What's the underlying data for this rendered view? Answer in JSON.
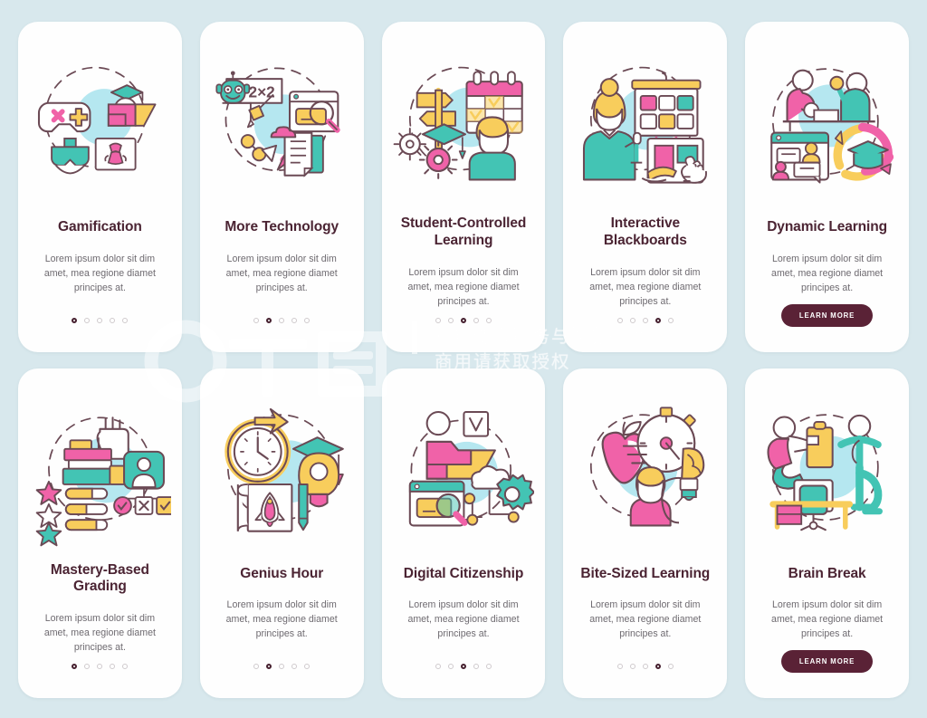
{
  "page": {
    "background_color": "#d8e8ed",
    "card_background": "#fefefe",
    "title_color": "#4b2433",
    "body_color": "#6e6a70",
    "accent_pink": "#f062a8",
    "accent_teal": "#43c4b4",
    "accent_yellow": "#f8cd5c",
    "accent_lightblue": "#b5e7f0",
    "outline_color": "#6b4a55",
    "cta_color": "#5a2236"
  },
  "watermark": {
    "logo_text": "千图",
    "line1": "营销创意服务与协作平台",
    "line2": "商用请获取授权"
  },
  "common": {
    "description": "Lorem ipsum dolor sit dim amet, mea regione diamet principes at.",
    "cta_label": "LEARN MORE",
    "dot_count": 5
  },
  "cards": [
    {
      "id": "gamification",
      "title": "Gamification",
      "icon_name": "gamepad-vr-graduation-icon",
      "description": "Lorem ipsum dolor sit dim amet, mea regione diamet principes at.",
      "active_dot": 0,
      "has_cta": false,
      "two_line_title": false
    },
    {
      "id": "more-technology",
      "title": "More Technology",
      "icon_name": "robot-browser-document-icon",
      "description": "Lorem ipsum dolor sit dim amet, mea regione diamet principes at.",
      "active_dot": 1,
      "has_cta": false,
      "two_line_title": false
    },
    {
      "id": "student-controlled-learning",
      "title": "Student-Controlled Learning",
      "icon_name": "calendar-signpost-student-icon",
      "description": "Lorem ipsum dolor sit dim amet, mea regione diamet principes at.",
      "active_dot": 2,
      "has_cta": false,
      "two_line_title": true
    },
    {
      "id": "interactive-blackboards",
      "title": "Interactive Blackboards",
      "icon_name": "teacher-board-tablet-icon",
      "description": "Lorem ipsum dolor sit dim amet, mea regione diamet principes at.",
      "active_dot": 3,
      "has_cta": false,
      "two_line_title": true
    },
    {
      "id": "dynamic-learning",
      "title": "Dynamic Learning",
      "icon_name": "students-chat-graduation-cycle-icon",
      "description": "Lorem ipsum dolor sit dim amet, mea regione diamet principes at.",
      "active_dot": -1,
      "has_cta": true,
      "cta_label": "LEARN MORE",
      "two_line_title": false
    },
    {
      "id": "mastery-based-grading",
      "title": "Mastery-Based Grading",
      "icon_name": "books-hand-stars-checklist-icon",
      "description": "Lorem ipsum dolor sit dim amet, mea regione diamet principes at.",
      "active_dot": 0,
      "has_cta": false,
      "two_line_title": true
    },
    {
      "id": "genius-hour",
      "title": "Genius Hour",
      "icon_name": "clock-rocket-lightbulb-icon",
      "description": "Lorem ipsum dolor sit dim amet, mea regione diamet principes at.",
      "active_dot": 1,
      "has_cta": false,
      "two_line_title": false
    },
    {
      "id": "digital-citizenship",
      "title": "Digital Citizenship",
      "icon_name": "folder-browser-cloud-gear-icon",
      "description": "Lorem ipsum dolor sit dim amet, mea regione diamet principes at.",
      "active_dot": 2,
      "has_cta": false,
      "two_line_title": false
    },
    {
      "id": "bite-sized-learning",
      "title": "Bite-Sized Learning",
      "icon_name": "apple-stopwatch-brain-bulb-icon",
      "description": "Lorem ipsum dolor sit dim amet, mea regione diamet principes at.",
      "active_dot": 3,
      "has_cta": false,
      "two_line_title": false
    },
    {
      "id": "brain-break",
      "title": "Brain Break",
      "icon_name": "desk-chair-stretching-people-icon",
      "description": "Lorem ipsum dolor sit dim amet, mea regione diamet principes at.",
      "active_dot": -1,
      "has_cta": true,
      "cta_label": "LEARN MORE",
      "two_line_title": false
    }
  ]
}
